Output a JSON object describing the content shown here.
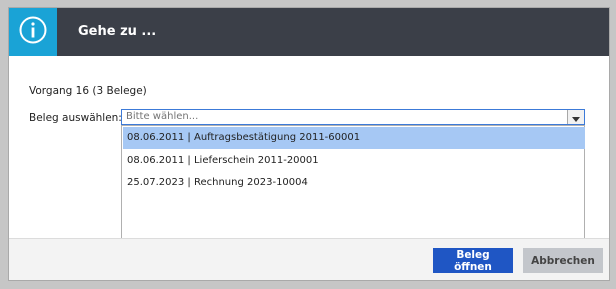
{
  "dialog": {
    "title": "Gehe zu ...",
    "icon": "info-circle-icon"
  },
  "content": {
    "vorgang_text": "Vorgang 16 (3 Belege)",
    "beleg_label": "Beleg auswählen:*",
    "select": {
      "placeholder": "Bitte wählen...",
      "value": ""
    },
    "options": [
      {
        "label": "08.06.2011 | Auftragsbestätigung 2011-60001",
        "highlighted": true
      },
      {
        "label": "08.06.2011 | Lieferschein 2011-20001",
        "highlighted": false
      },
      {
        "label": "25.07.2023 | Rechnung 2023-10004",
        "highlighted": false
      }
    ]
  },
  "footer": {
    "open_label": "Beleg öffnen",
    "cancel_label": "Abbrechen"
  },
  "colors": {
    "header_bg": "#3b3f48",
    "info_accent": "#1aa3d6",
    "highlight": "#a6c8f4",
    "primary_button": "#1f56c4",
    "secondary_button": "#c3c6cb"
  }
}
